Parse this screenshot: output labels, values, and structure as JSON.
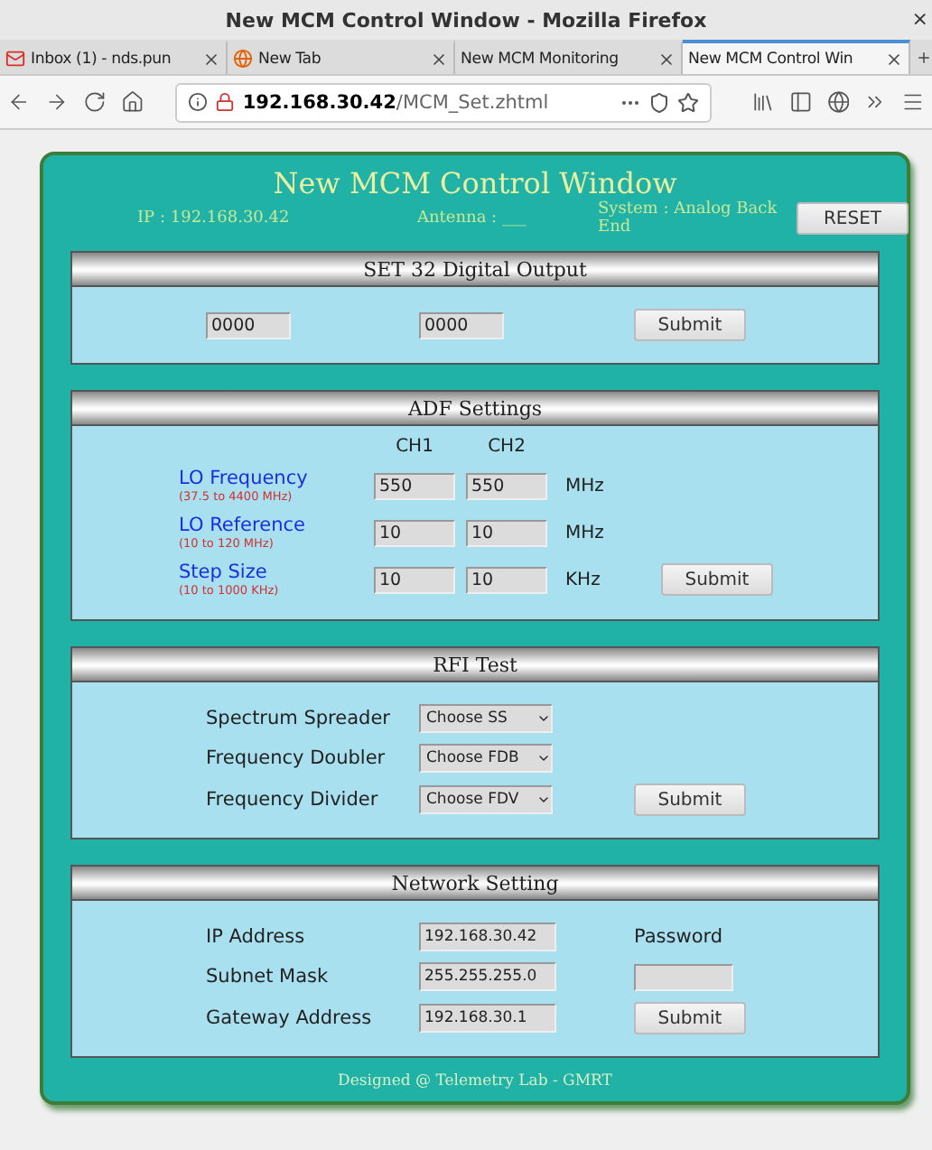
{
  "browser": {
    "title": "New MCM Control Window - Mozilla Firefox",
    "close": "×",
    "tabs": [
      {
        "label": "Inbox (1) - nds.pun",
        "selected": false
      },
      {
        "label": "New Tab",
        "selected": false
      },
      {
        "label": "New MCM Monitoring",
        "selected": false
      },
      {
        "label": "New MCM Control Win",
        "selected": true
      }
    ],
    "url": {
      "host": "192.168.30.42",
      "path": "/MCM_Set.zhtml"
    }
  },
  "page": {
    "title": "New MCM Control Window",
    "ip": "IP : 192.168.30.42",
    "antenna": "Antenna : ___",
    "system": "System : Analog Back End",
    "reset": "RESET",
    "footer": "Designed @ Telemetry Lab - GMRT",
    "digital": {
      "title": "SET 32 Digital Output",
      "fields": [
        "0000",
        "0000"
      ],
      "submit": "Submit"
    },
    "adf": {
      "title": "ADF Settings",
      "columns": [
        "CH1",
        "CH2"
      ],
      "submit": "Submit",
      "rows": [
        {
          "label": "LO Frequency",
          "range": "(37.5 to 4400 MHz)",
          "ch1": "550",
          "ch2": "550",
          "unit": "MHz"
        },
        {
          "label": "LO Reference",
          "range": "(10 to 120 MHz)",
          "ch1": "10",
          "ch2": "10",
          "unit": "MHz"
        },
        {
          "label": "Step Size",
          "range": "(10 to 1000 KHz)",
          "ch1": "10",
          "ch2": "10",
          "unit": "KHz"
        }
      ]
    },
    "rfi": {
      "title": "RFI Test",
      "submit": "Submit",
      "rows": [
        {
          "label": "Spectrum Spreader",
          "value": "Choose SS"
        },
        {
          "label": "Frequency Doubler",
          "value": "Choose FDB"
        },
        {
          "label": "Frequency Divider",
          "value": "Choose FDV"
        }
      ]
    },
    "network": {
      "title": "Network Setting",
      "password": "Password",
      "submit": "Submit",
      "rows": [
        {
          "label": "IP Address",
          "value": "192.168.30.42"
        },
        {
          "label": "Subnet Mask",
          "value": "255.255.255.0"
        },
        {
          "label": "Gateway Address",
          "value": "192.168.30.1"
        }
      ]
    }
  }
}
